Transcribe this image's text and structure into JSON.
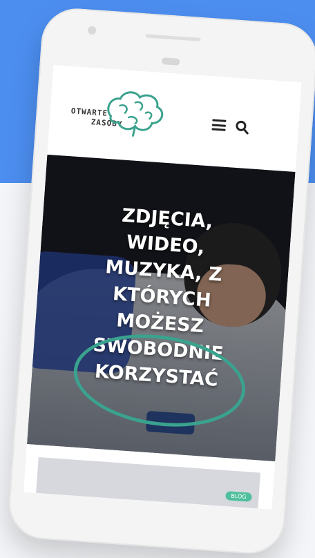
{
  "logo": {
    "line1": "OTWARTE",
    "line2": "ZASOBY"
  },
  "header": {
    "menu_icon": "hamburger-menu-icon",
    "search_icon": "search-icon"
  },
  "hero": {
    "title_lines": [
      "ZDJĘCIA,",
      "WIDEO,",
      "MUZYKA, Z",
      "KTÓRYCH",
      "MOŻESZ",
      "SWOBODNIE",
      "KORZYSTAĆ"
    ]
  },
  "card": {
    "tag": "BLOG"
  },
  "colors": {
    "background_top": "#4c8ef0",
    "accent_circle": "#3aa28e",
    "tag": "#4fbf9d"
  }
}
